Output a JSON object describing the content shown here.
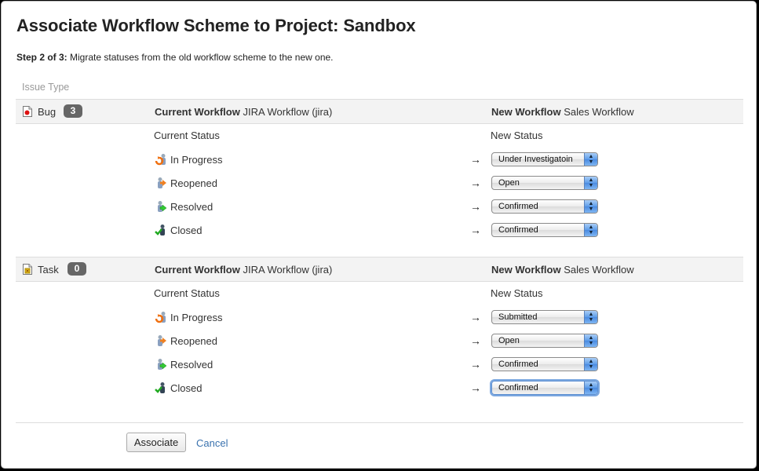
{
  "page": {
    "title": "Associate Workflow Scheme to Project: Sandbox",
    "step_label": "Step 2 of 3:",
    "step_text": " Migrate statuses from the old workflow scheme to the new one.",
    "issue_type_column": "Issue Type"
  },
  "labels": {
    "current_workflow": "Current Workflow",
    "new_workflow": "New Workflow",
    "current_status": "Current Status",
    "new_status": "New Status",
    "arrow": "→",
    "select_arrow": "▲\n▼"
  },
  "issue_types": [
    {
      "name": "Bug",
      "icon": "bug-icon",
      "count": "3",
      "current_workflow": "JIRA Workflow (jira)",
      "new_workflow": "Sales Workflow",
      "mappings": [
        {
          "status": "In Progress",
          "icon": "in-progress-icon",
          "new_status": "Under Investigatoin"
        },
        {
          "status": "Reopened",
          "icon": "reopened-icon",
          "new_status": "Open"
        },
        {
          "status": "Resolved",
          "icon": "resolved-icon",
          "new_status": "Confirmed"
        },
        {
          "status": "Closed",
          "icon": "closed-icon",
          "new_status": "Confirmed"
        }
      ]
    },
    {
      "name": "Task",
      "icon": "task-icon",
      "count": "0",
      "current_workflow": "JIRA Workflow (jira)",
      "new_workflow": "Sales Workflow",
      "mappings": [
        {
          "status": "In Progress",
          "icon": "in-progress-icon",
          "new_status": "Submitted"
        },
        {
          "status": "Reopened",
          "icon": "reopened-icon",
          "new_status": "Open"
        },
        {
          "status": "Resolved",
          "icon": "resolved-icon",
          "new_status": "Confirmed"
        },
        {
          "status": "Closed",
          "icon": "closed-icon",
          "new_status": "Confirmed",
          "focused": true
        }
      ]
    }
  ],
  "actions": {
    "associate_label": "Associate",
    "cancel_label": "Cancel"
  }
}
